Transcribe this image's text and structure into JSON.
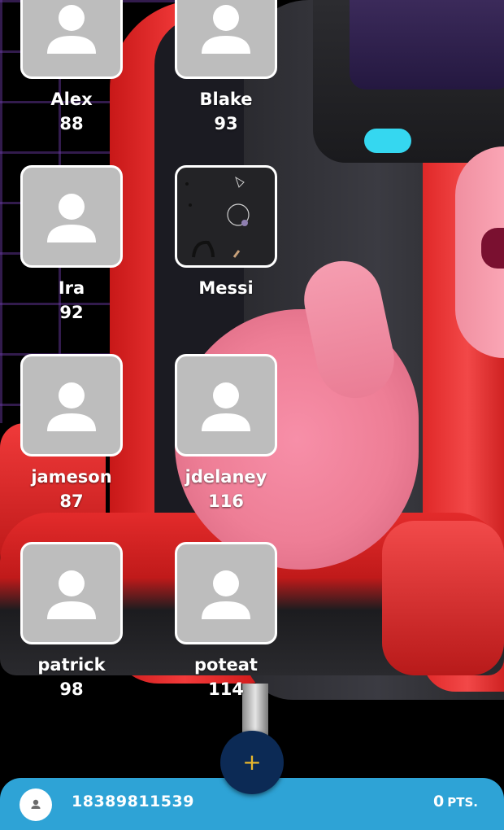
{
  "friends": [
    {
      "name": "Alex",
      "score": "88",
      "avatar": "default-avatar-icon"
    },
    {
      "name": "Blake",
      "score": "93",
      "avatar": "default-avatar-icon"
    },
    {
      "name": "Ira",
      "score": "92",
      "avatar": "default-avatar-icon"
    },
    {
      "name": "Messi",
      "score": "",
      "avatar": "photo"
    },
    {
      "name": "jameson",
      "score": "87",
      "avatar": "default-avatar-icon"
    },
    {
      "name": "jdelaney",
      "score": "116",
      "avatar": "default-avatar-icon"
    },
    {
      "name": "patrick",
      "score": "98",
      "avatar": "default-avatar-icon"
    },
    {
      "name": "poteat",
      "score": "114",
      "avatar": "default-avatar-icon"
    }
  ],
  "fab": {
    "icon": "plus-icon",
    "symbol": "+"
  },
  "bottom_bar": {
    "user_id": "18389811539",
    "points_value": "0",
    "points_unit": "PTS."
  },
  "colors": {
    "bottom_bar": "#2ea3d6",
    "fab_bg": "#0c2a55",
    "fab_icon": "#e9b72c",
    "avatar_placeholder": "#bdbdbd"
  }
}
